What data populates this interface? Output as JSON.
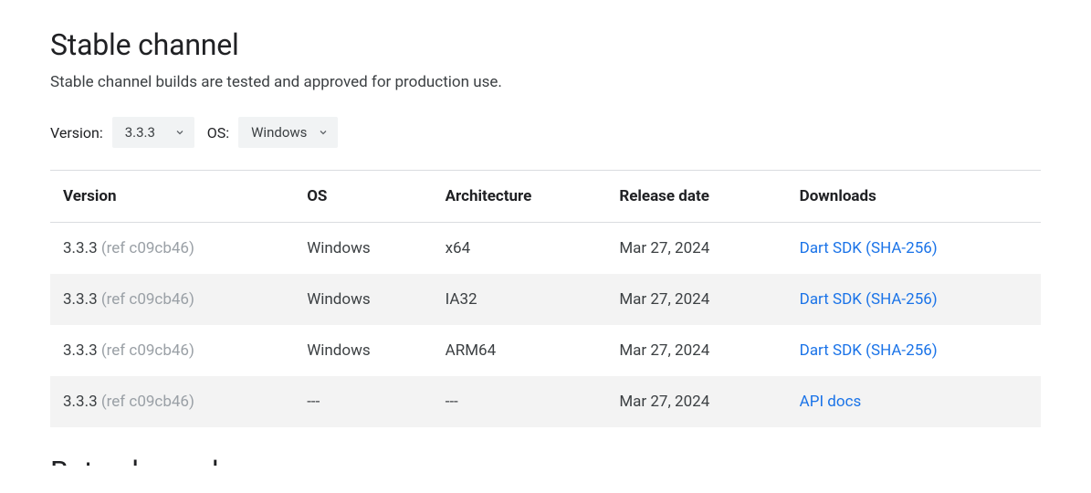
{
  "heading": "Stable channel",
  "description": "Stable channel builds are tested and approved for production use.",
  "filters": {
    "version_label": "Version:",
    "version_value": "3.3.3",
    "os_label": "OS:",
    "os_value": "Windows"
  },
  "table": {
    "headers": {
      "version": "Version",
      "os": "OS",
      "architecture": "Architecture",
      "release_date": "Release date",
      "downloads": "Downloads"
    },
    "rows": [
      {
        "version": "3.3.3",
        "ref": "(ref c09cb46)",
        "os": "Windows",
        "architecture": "x64",
        "release_date": "Mar 27, 2024",
        "download_main": "Dart SDK",
        "download_extra": "(SHA-256)"
      },
      {
        "version": "3.3.3",
        "ref": "(ref c09cb46)",
        "os": "Windows",
        "architecture": "IA32",
        "release_date": "Mar 27, 2024",
        "download_main": "Dart SDK",
        "download_extra": "(SHA-256)"
      },
      {
        "version": "3.3.3",
        "ref": "(ref c09cb46)",
        "os": "Windows",
        "architecture": "ARM64",
        "release_date": "Mar 27, 2024",
        "download_main": "Dart SDK",
        "download_extra": "(SHA-256)"
      },
      {
        "version": "3.3.3",
        "ref": "(ref c09cb46)",
        "os": "---",
        "architecture": "---",
        "release_date": "Mar 27, 2024",
        "download_main": "API docs",
        "download_extra": ""
      }
    ]
  },
  "next_heading": "Beta channel"
}
